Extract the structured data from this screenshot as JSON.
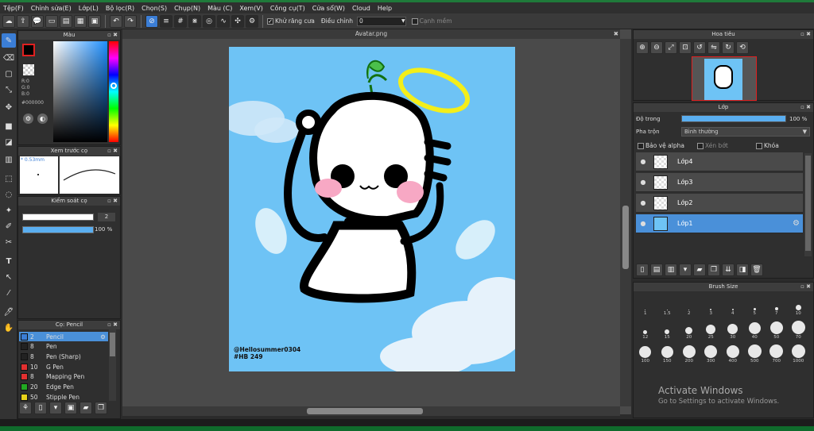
{
  "menu": [
    "Tệp(F)",
    "Chỉnh sửa(E)",
    "Lớp(L)",
    "Bộ lọc(R)",
    "Chọn(S)",
    "Chụp(N)",
    "Màu (C)",
    "Xem(V)",
    "Công cụ(T)",
    "Cửa sổ(W)",
    "Cloud",
    "Help"
  ],
  "toolbar": {
    "antialias_label": "Khử răng cưa",
    "adjust_label": "Điều chỉnh",
    "adjust_value": "0",
    "edge_label": "Cạnh mềm"
  },
  "color_panel": {
    "title": "Màu",
    "r": "R:0",
    "g": "G:0",
    "b": "B:0",
    "hex": "#000000"
  },
  "preview_panel": {
    "title": "Xem trước cọ",
    "size": "* 0.53mm"
  },
  "brush_control": {
    "title": "Kiểm soát cọ",
    "size_value": "2",
    "opacity_value": "100 %"
  },
  "brush_list": {
    "title": "Cọ: Pencil",
    "items": [
      {
        "num": "2",
        "name": "Pencil",
        "color": "#3b7ed6",
        "selected": true
      },
      {
        "num": "8",
        "name": "Pen",
        "color": "#222222",
        "selected": false
      },
      {
        "num": "8",
        "name": "Pen (Sharp)",
        "color": "#222222",
        "selected": false
      },
      {
        "num": "10",
        "name": "G Pen",
        "color": "#e23030",
        "selected": false
      },
      {
        "num": "8",
        "name": "Mapping Pen",
        "color": "#e23030",
        "selected": false
      },
      {
        "num": "20",
        "name": "Edge Pen",
        "color": "#22aa22",
        "selected": false
      },
      {
        "num": "50",
        "name": "Stipple Pen",
        "color": "#e8d21a",
        "selected": false
      }
    ]
  },
  "canvas": {
    "tab": "Avatar.png",
    "watermark_line1": "@Hellosummer0304",
    "watermark_line2": "#HB 249"
  },
  "navigator": {
    "title": "Hoa tiêu"
  },
  "layer_panel": {
    "title": "Lớp",
    "opacity_label": "Độ trong",
    "opacity_value": "100 %",
    "blend_label": "Pha trộn",
    "blend_value": "Bình thường",
    "protect_alpha": "Bảo vệ alpha",
    "clip": "Xén bớt",
    "lock": "Khóa",
    "layers": [
      {
        "name": "Lớp4",
        "selected": false
      },
      {
        "name": "Lớp3",
        "selected": false
      },
      {
        "name": "Lớp2",
        "selected": false
      },
      {
        "name": "Lớp1",
        "selected": true
      }
    ]
  },
  "brush_size": {
    "title": "Brush Size",
    "row1": [
      "1",
      "1.5",
      "2",
      "3",
      "4",
      "5",
      "7",
      "10"
    ],
    "row2": [
      "12",
      "15",
      "20",
      "25",
      "30",
      "40",
      "50",
      "70"
    ],
    "row3": [
      "100",
      "150",
      "200",
      "300",
      "400",
      "500",
      "700",
      "1000"
    ]
  },
  "activation": {
    "line1": "Activate Windows",
    "line2": "Go to Settings to activate Windows."
  }
}
